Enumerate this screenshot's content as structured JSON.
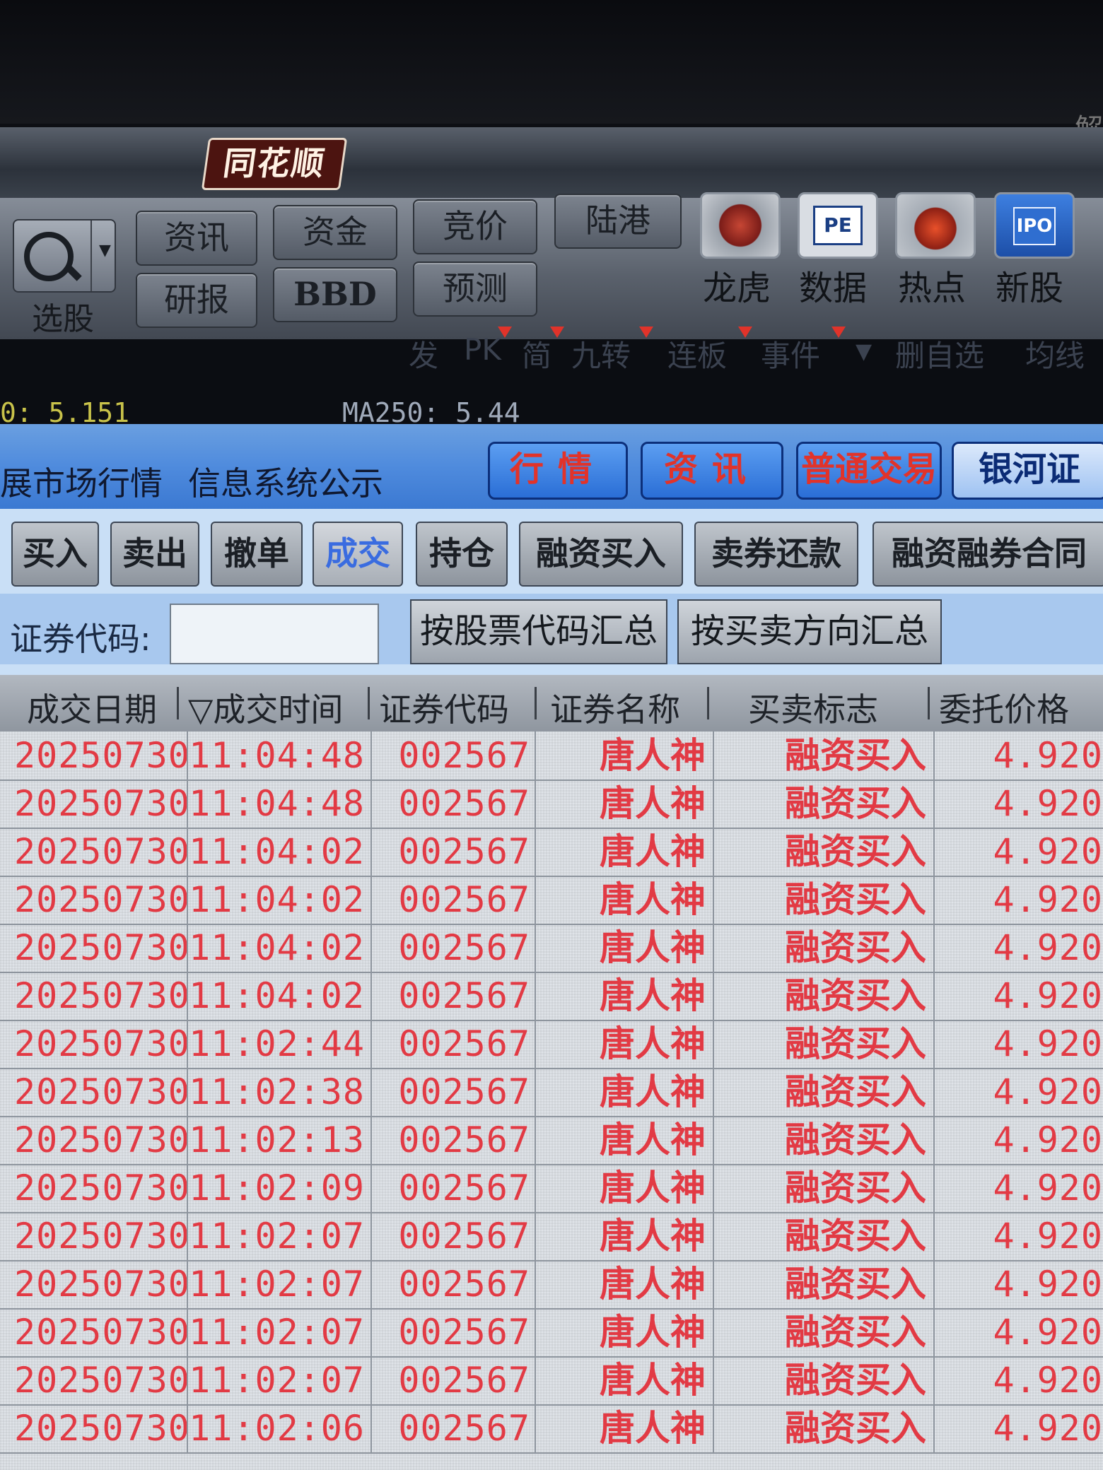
{
  "app": {
    "logo_text": "同花顺"
  },
  "toolbar": {
    "select_label": "选股",
    "buttons": [
      "资讯",
      "资金",
      "竞价",
      "陆港",
      "研报",
      "BBD",
      "预测"
    ],
    "big_icons": [
      {
        "label": "龙虎",
        "icon": "dragon-icon"
      },
      {
        "label": "数据",
        "icon": "pe-icon",
        "glyph": "PE"
      },
      {
        "label": "热点",
        "icon": "fire-icon"
      },
      {
        "label": "新股",
        "icon": "ipo-icon",
        "glyph": "IPO"
      }
    ]
  },
  "quick_links": [
    "发",
    "PK",
    "简",
    "九转",
    "连板",
    "事件",
    "删自选",
    "均线"
  ],
  "ma_readout": {
    "left": "0: 5.151",
    "ma250": "MA250: 5.44"
  },
  "blue_band": {
    "links": [
      "展市场行情",
      "信息系统公示"
    ],
    "tabs": [
      "行情",
      "资讯",
      "普通交易",
      "银河证"
    ]
  },
  "trade_tabs": [
    "买入",
    "卖出",
    "撤单",
    "成交",
    "持仓",
    "融资买入",
    "卖券还款",
    "融资融券合同"
  ],
  "query": {
    "code_label": "证券代码:",
    "code_value": "",
    "summary_by_code": "按股票代码汇总",
    "summary_by_side": "按买卖方向汇总"
  },
  "table": {
    "headers": [
      "成交日期",
      "▽成交时间",
      "证券代码",
      "证券名称",
      "买卖标志",
      "委托价格"
    ],
    "rows": [
      [
        "20250730",
        "11:04:48",
        "002567",
        "唐人神",
        "融资买入",
        "4.920"
      ],
      [
        "20250730",
        "11:04:48",
        "002567",
        "唐人神",
        "融资买入",
        "4.920"
      ],
      [
        "20250730",
        "11:04:02",
        "002567",
        "唐人神",
        "融资买入",
        "4.920"
      ],
      [
        "20250730",
        "11:04:02",
        "002567",
        "唐人神",
        "融资买入",
        "4.920"
      ],
      [
        "20250730",
        "11:04:02",
        "002567",
        "唐人神",
        "融资买入",
        "4.920"
      ],
      [
        "20250730",
        "11:04:02",
        "002567",
        "唐人神",
        "融资买入",
        "4.920"
      ],
      [
        "20250730",
        "11:02:44",
        "002567",
        "唐人神",
        "融资买入",
        "4.920"
      ],
      [
        "20250730",
        "11:02:38",
        "002567",
        "唐人神",
        "融资买入",
        "4.920"
      ],
      [
        "20250730",
        "11:02:13",
        "002567",
        "唐人神",
        "融资买入",
        "4.920"
      ],
      [
        "20250730",
        "11:02:09",
        "002567",
        "唐人神",
        "融资买入",
        "4.920"
      ],
      [
        "20250730",
        "11:02:07",
        "002567",
        "唐人神",
        "融资买入",
        "4.920"
      ],
      [
        "20250730",
        "11:02:07",
        "002567",
        "唐人神",
        "融资买入",
        "4.920"
      ],
      [
        "20250730",
        "11:02:07",
        "002567",
        "唐人神",
        "融资买入",
        "4.920"
      ],
      [
        "20250730",
        "11:02:07",
        "002567",
        "唐人神",
        "融资买入",
        "4.920"
      ],
      [
        "20250730",
        "11:02:06",
        "002567",
        "唐人神",
        "融资买入",
        "4.920"
      ]
    ]
  },
  "colors": {
    "trade_text": "#e23a44",
    "active_tab_text": "#3a6ce0",
    "band_blue": "#4f8bdd"
  }
}
